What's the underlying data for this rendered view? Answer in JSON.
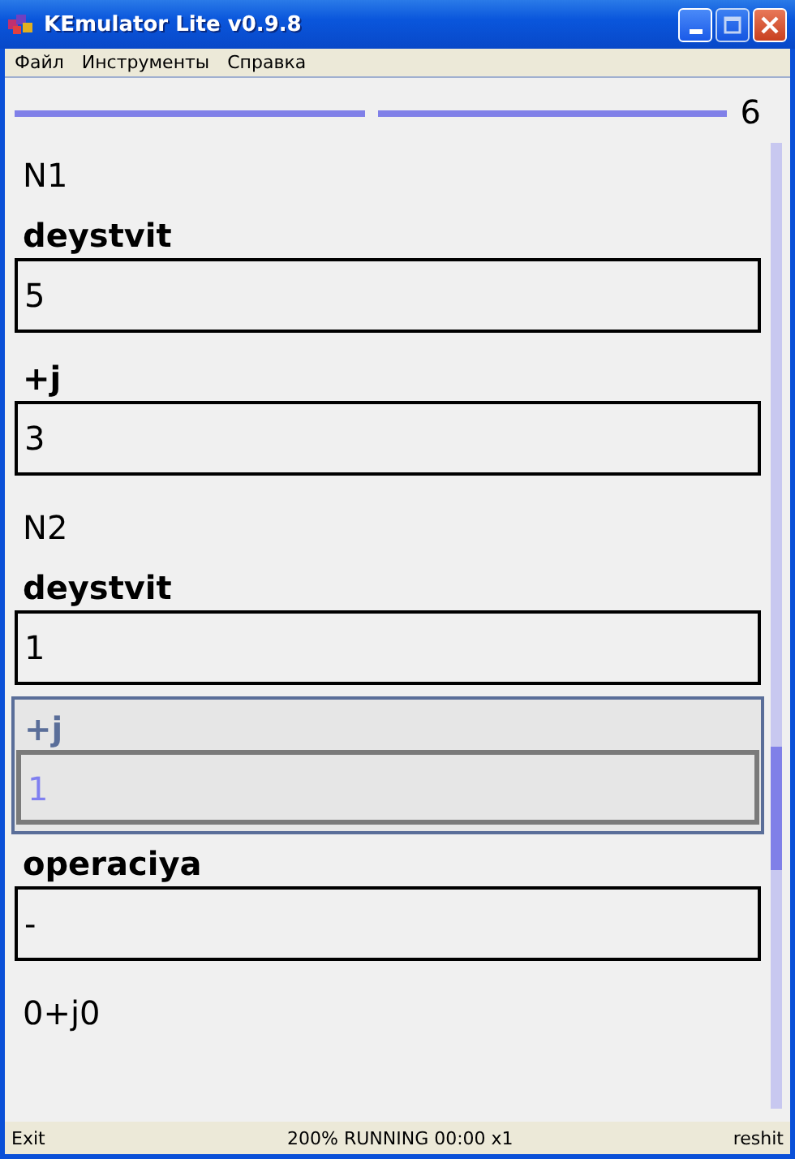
{
  "window": {
    "title": "KEmulator Lite v0.9.8"
  },
  "menu": [
    "Файл",
    "Инструменты",
    "Справка"
  ],
  "screen": {
    "page": "6",
    "items": [
      {
        "kind": "text",
        "text": "N1"
      },
      {
        "kind": "field",
        "label": "deystvit",
        "value": "5",
        "selected": false
      },
      {
        "kind": "field",
        "label": "+j",
        "value": "3",
        "selected": false
      },
      {
        "kind": "text",
        "text": "N2"
      },
      {
        "kind": "field",
        "label": "deystvit",
        "value": "1",
        "selected": false
      },
      {
        "kind": "field",
        "label": "+j",
        "value": "1",
        "selected": true
      },
      {
        "kind": "field",
        "label": "operaciya",
        "value": "-",
        "selected": false
      },
      {
        "kind": "text",
        "text": "0+j0"
      }
    ]
  },
  "status_bar": {
    "left": "Exit",
    "center": "200%  RUNNING  00:00  x1",
    "right": "reshit"
  }
}
